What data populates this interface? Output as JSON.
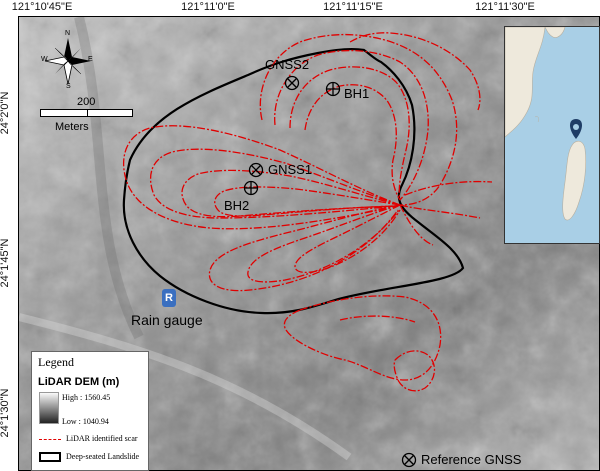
{
  "map": {
    "top_coords": [
      "121°10'45\"E",
      "121°11'0\"E",
      "121°11'15\"E",
      "121°11'30\"E"
    ],
    "left_coords": [
      "24°2'0\"N",
      "24°1'45\"N",
      "24°1'30\"N"
    ],
    "compass": {
      "n": "N",
      "s": "S",
      "e": "E",
      "w": "W"
    },
    "scale": {
      "value": "200",
      "unit": "Meters"
    },
    "labels": {
      "gnss2": "GNSS2",
      "bh1": "BH1",
      "gnss1": "GNSS1",
      "bh2": "BH2",
      "rain_gauge": "Rain gauge",
      "rain_icon": "R",
      "reference_gnss": "Reference GNSS"
    },
    "colors": {
      "scar": "#e00000",
      "landslide": "#000000",
      "sea": "#a9cfe6",
      "land": "#eee9dc",
      "pin": "#1f3d66"
    }
  },
  "legend": {
    "title": "Legend",
    "dem_title": "LiDAR DEM (m)",
    "high": "High : 1560.45",
    "low": "Low : 1040.94",
    "scar": "LiDAR identified scar",
    "landslide": "Deep-seated Landslide"
  }
}
